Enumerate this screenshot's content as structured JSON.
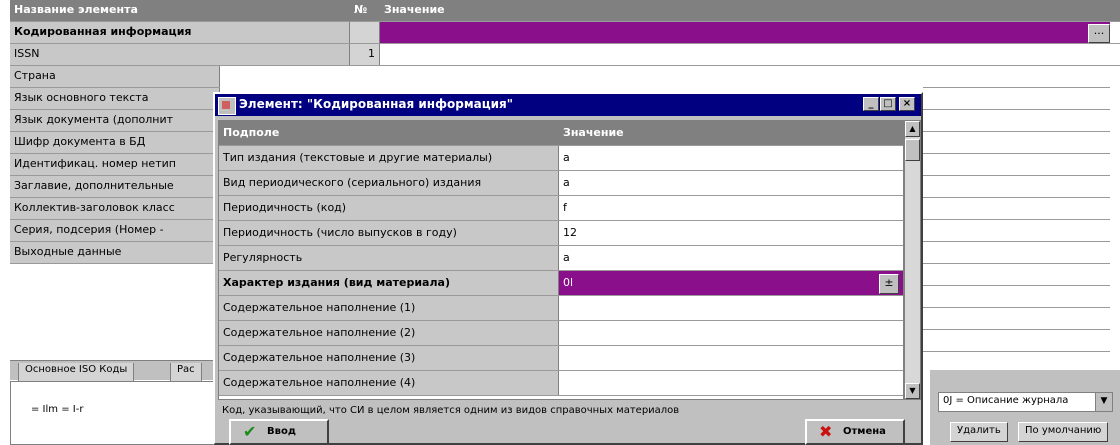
{
  "grid": {
    "headers": {
      "name": "Название элемента",
      "num": "№",
      "value": "Значение"
    },
    "rows": [
      {
        "name": "Кодированная информация",
        "num": "",
        "value": "",
        "bold": true,
        "selected": true
      },
      {
        "name": "ISSN",
        "num": "1",
        "value": ""
      },
      {
        "name": "Страна",
        "num": "",
        "value": ""
      },
      {
        "name": "Язык основного текста",
        "num": "",
        "value": ""
      },
      {
        "name": "Язык документа (дополнит",
        "num": "",
        "value": ""
      },
      {
        "name": "Шифр документа в БД",
        "num": "",
        "value": ""
      },
      {
        "name": "Идентификац. номер нетип",
        "num": "",
        "value": ""
      },
      {
        "name": "Заглавие, дополнительные",
        "num": "",
        "value": ""
      },
      {
        "name": "Коллектив-заголовок класс",
        "num": "",
        "value": ""
      },
      {
        "name": "Серия, подсерия (Номер -",
        "num": "",
        "value": ""
      },
      {
        "name": "Выходные данные",
        "num": "",
        "value": ""
      }
    ],
    "ellipsis": "..."
  },
  "tabs": [
    "Основное ISO Коды",
    "Рас"
  ],
  "bottom_left_text": "= Ilm = I-r",
  "bottom_right": {
    "combo_value": "0J = Описание журнала",
    "buttons": [
      "Удалить",
      "По умолчанию"
    ]
  },
  "dialog": {
    "title": "Элемент: \"Кодированная информация\"",
    "title_buttons": [
      "_",
      "□",
      "×"
    ],
    "headers": {
      "sub": "Подполе",
      "value": "Значение"
    },
    "rows": [
      {
        "sub": "Тип издания (текстовые и другие материалы)",
        "value": "a"
      },
      {
        "sub": "Вид периодического (сериального) издания",
        "value": "a"
      },
      {
        "sub": "Периодичность (код)",
        "value": "f"
      },
      {
        "sub": "Периодичность (число выпусков в году)",
        "value": "12"
      },
      {
        "sub": "Регулярность",
        "value": "a"
      },
      {
        "sub": "Характер издания (вид материала)",
        "value": "0l",
        "bold": true,
        "selected": true
      },
      {
        "sub": "Содержательное наполнение (1)",
        "value": ""
      },
      {
        "sub": "Содержательное наполнение (2)",
        "value": ""
      },
      {
        "sub": "Содержательное наполнение (3)",
        "value": ""
      },
      {
        "sub": "Содержательное наполнение (4)",
        "value": ""
      }
    ],
    "spin_symbol": "±",
    "hint": "Код, указывающий, что СИ в целом является одним из видов справочных материалов",
    "ok_label": "Ввод",
    "cancel_label": "Отмена"
  },
  "colors": {
    "purple": "#8a0f8a",
    "navy": "#000080"
  },
  "icons": {
    "ok": "check-icon",
    "cancel": "cross-icon"
  }
}
